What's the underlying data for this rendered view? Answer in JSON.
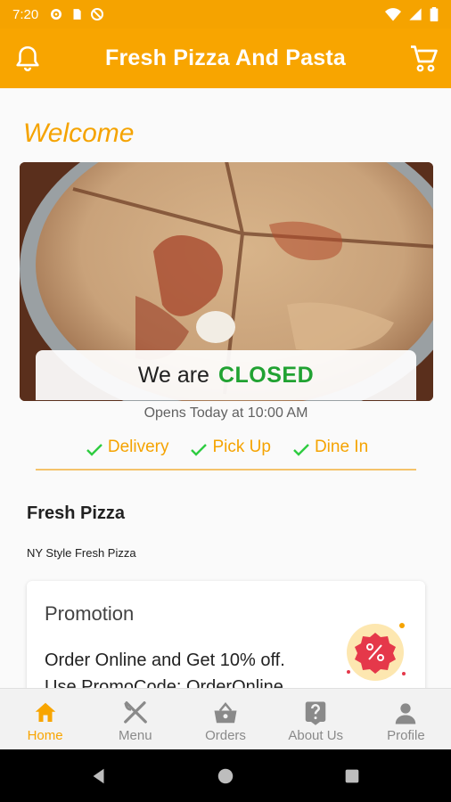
{
  "status_bar": {
    "time": "7:20"
  },
  "app_bar": {
    "title": "Fresh Pizza And Pasta"
  },
  "welcome": "Welcome",
  "status": {
    "prefix": "We are",
    "state": "CLOSED",
    "opens": "Opens Today at 10:00 AM"
  },
  "services": [
    "Delivery",
    "Pick Up",
    "Dine In"
  ],
  "business": {
    "name": "Fresh Pizza",
    "description": "NY Style Fresh Pizza"
  },
  "promotion": {
    "title": "Promotion",
    "text": "Order Online and Get 10% off. Use PromoCode: OrderOnline"
  },
  "nav": {
    "items": [
      {
        "label": "Home",
        "icon": "home-icon",
        "active": true
      },
      {
        "label": "Menu",
        "icon": "fork-knife-icon",
        "active": false
      },
      {
        "label": "Orders",
        "icon": "basket-icon",
        "active": false
      },
      {
        "label": "About Us",
        "icon": "help-icon",
        "active": false
      },
      {
        "label": "Profile",
        "icon": "person-icon",
        "active": false
      }
    ]
  },
  "colors": {
    "accent": "#f8a500",
    "closed": "#21a232",
    "check": "#2ecc40"
  }
}
